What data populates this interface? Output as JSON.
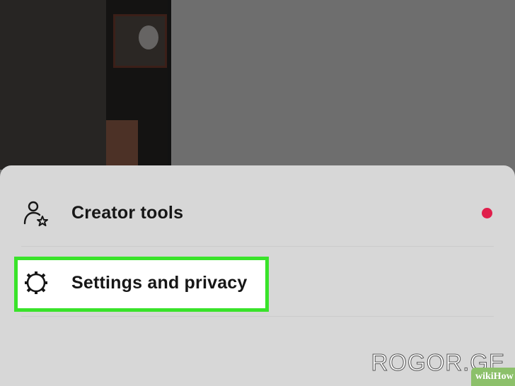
{
  "menu": {
    "items": [
      {
        "label": "Creator tools",
        "icon": "person-star-icon",
        "has_notification": true
      },
      {
        "label": "Settings and privacy",
        "icon": "gear-icon",
        "highlighted": true
      }
    ]
  },
  "colors": {
    "sheet_bg": "#d7d7d7",
    "highlight": "#39e32a",
    "notification": "#e01e4b"
  },
  "watermark": {
    "text": "ROGOR.GE",
    "badge": "wikiHow"
  }
}
